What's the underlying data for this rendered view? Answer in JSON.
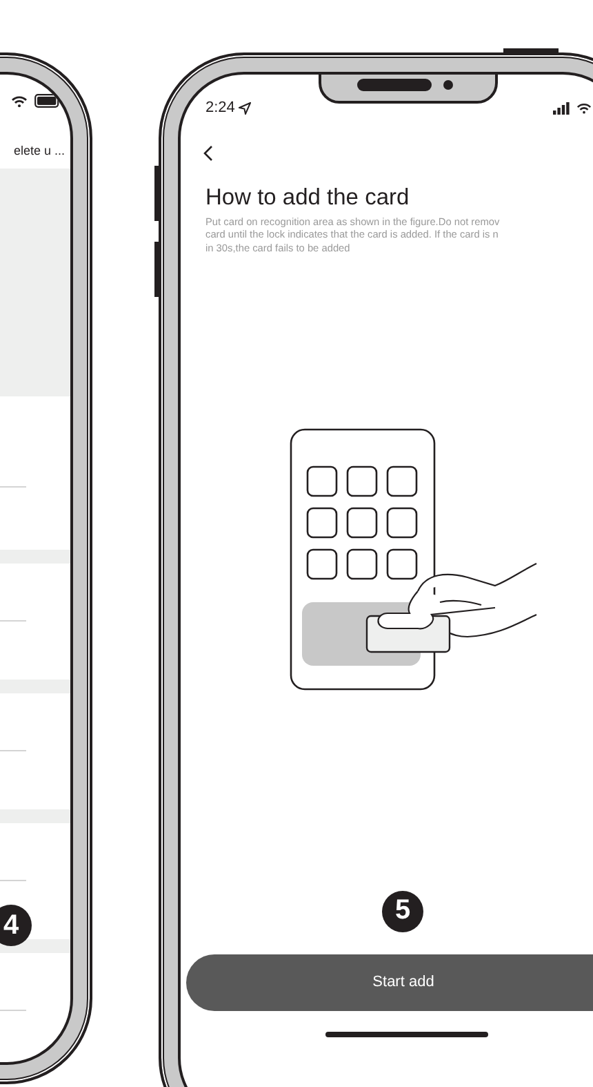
{
  "left_phone": {
    "header_title": "elete u ...",
    "step_badge": "4"
  },
  "right_phone": {
    "status_bar": {
      "time": "2:24"
    },
    "title": "How to add the card",
    "description_lines": [
      "Put card on recognition area as shown in the figure.Do not  remov",
      "card until the lock indicates that the card is added. If the card is n",
      "in 30s,the card fails to be added"
    ],
    "step_badge": "5",
    "start_button": "Start add"
  }
}
